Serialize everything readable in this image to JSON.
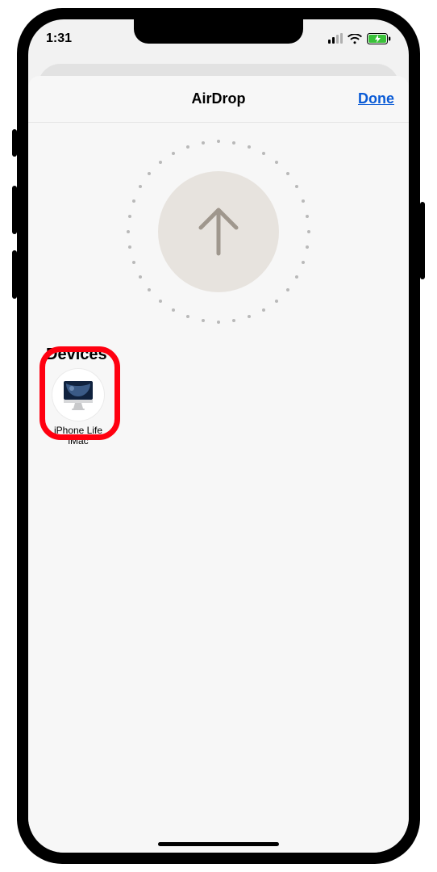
{
  "statusBar": {
    "time": "1:31"
  },
  "sheet": {
    "title": "AirDrop",
    "doneLabel": "Done"
  },
  "sections": {
    "devicesTitle": "Devices"
  },
  "devices": [
    {
      "name": "iPhone Life iMac"
    }
  ]
}
